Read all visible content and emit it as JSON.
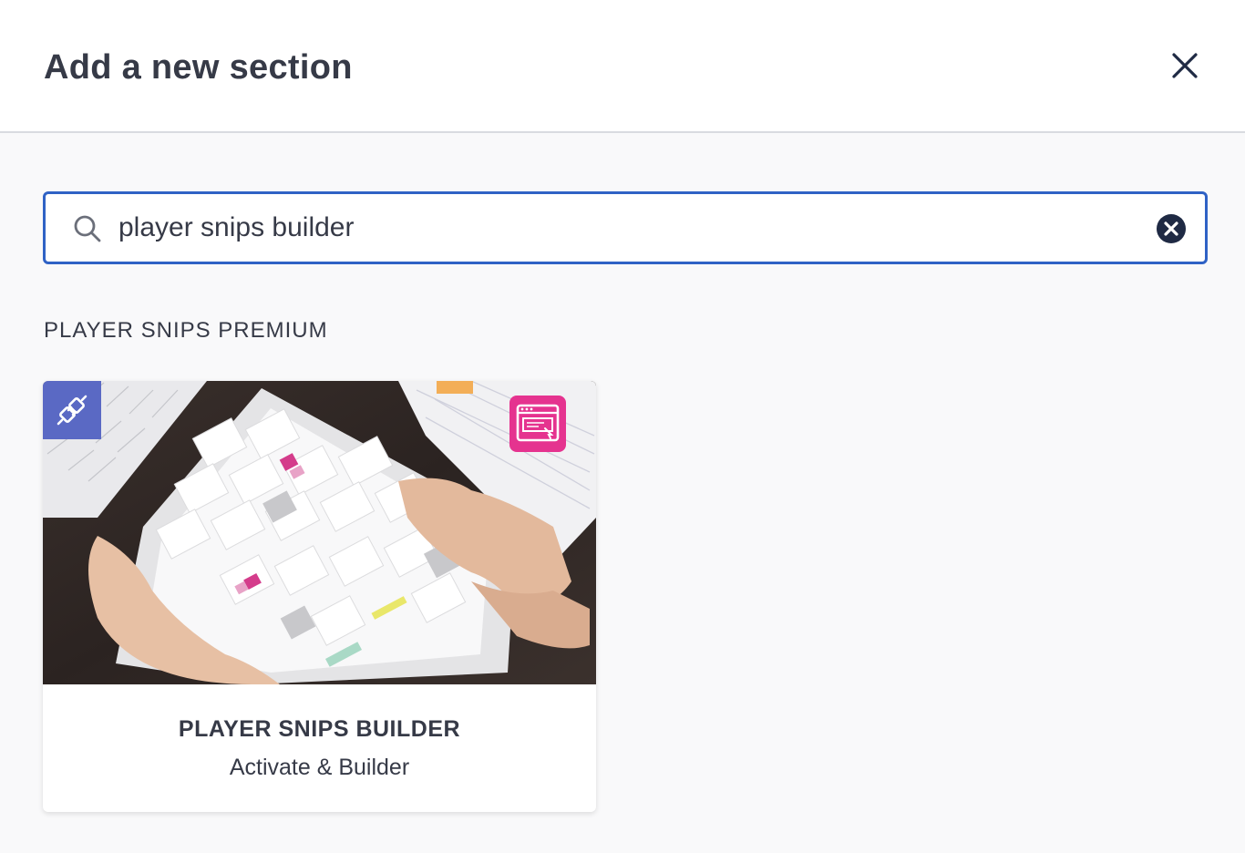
{
  "dialog": {
    "title": "Add a new section",
    "close_icon": "close-icon"
  },
  "search": {
    "value": "player snips builder",
    "search_icon": "search-icon",
    "clear_icon": "clear-circle-icon",
    "accent_color": "#2f62c5"
  },
  "results": {
    "heading": "PLAYER SNIPS PREMIUM",
    "cards": [
      {
        "title": "PLAYER SNIPS BUILDER",
        "subtitle": "Activate & Builder",
        "badge_icon": "plug-icon",
        "badge_color": "#5a69c4",
        "brand_icon": "browser-window-icon",
        "brand_color": "#e5338f"
      }
    ]
  }
}
